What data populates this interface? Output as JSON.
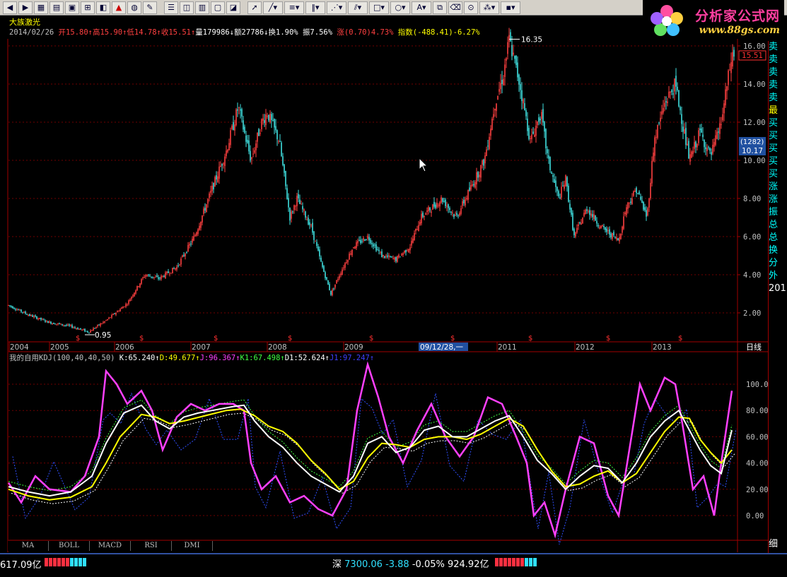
{
  "stock": {
    "name": "大族激光"
  },
  "quote": [
    {
      "text": "2014/02/26 ",
      "color": "#c0c0c0"
    },
    {
      "text": "开15.80",
      "color": "#ff4040"
    },
    {
      "text": "↑",
      "color": "#ff4040"
    },
    {
      "text": "高15.90",
      "color": "#ff4040"
    },
    {
      "text": "↑",
      "color": "#ff4040"
    },
    {
      "text": "低14.78",
      "color": "#ff4040"
    },
    {
      "text": "↑",
      "color": "#ff4040"
    },
    {
      "text": "收15.51",
      "color": "#ff4040"
    },
    {
      "text": "↑",
      "color": "#ff4040"
    },
    {
      "text": "量179986",
      "color": "#ffffff"
    },
    {
      "text": "↓",
      "color": "#ffffff"
    },
    {
      "text": "额27786",
      "color": "#ffffff"
    },
    {
      "text": "↓",
      "color": "#ffffff"
    },
    {
      "text": "换1.90% ",
      "color": "#ffffff"
    },
    {
      "text": "振7.56% ",
      "color": "#ffffff"
    },
    {
      "text": "涨",
      "color": "#ff4040"
    },
    {
      "text": "(0.70)",
      "color": "#ff4040"
    },
    {
      "text": "4.73% ",
      "color": "#ff4040"
    },
    {
      "text": "指数",
      "color": "#ffff00"
    },
    {
      "text": "(-488.41)",
      "color": "#ffff00"
    },
    {
      "text": "-6.27%",
      "color": "#ffff00"
    }
  ],
  "price_axis": {
    "labels": [
      "16.00",
      "14.00",
      "12.00",
      "10.00",
      "8.00",
      "6.00",
      "4.00",
      "2.00"
    ],
    "current_price": "15.51",
    "cursor_count": "(1282)",
    "cursor_price": "10.17"
  },
  "annotations": {
    "high": "16.35",
    "low": "0.95"
  },
  "time_axis": {
    "labels": [
      "2004",
      "2005",
      "2006",
      "2007",
      "2008",
      "2009",
      "2011",
      "2012",
      "2013"
    ],
    "cursor_date": "09/12/28,一",
    "period": "日线"
  },
  "kdj": {
    "header": [
      {
        "text": "我的自用KDJ(100,40,40,50) ",
        "color": "#c0c0c0"
      },
      {
        "text": "K:65.240",
        "color": "#ffffff"
      },
      {
        "text": "↑",
        "color": "#ffffff"
      },
      {
        "text": "D:49.677",
        "color": "#ffff00"
      },
      {
        "text": "↑",
        "color": "#ffff00"
      },
      {
        "text": "J:96.367",
        "color": "#ff40ff"
      },
      {
        "text": "↑",
        "color": "#ff40ff"
      },
      {
        "text": "K1:67.498",
        "color": "#40ff40"
      },
      {
        "text": "↑",
        "color": "#40ff40"
      },
      {
        "text": "D1:52.624",
        "color": "#ffffff"
      },
      {
        "text": "↑",
        "color": "#ffffff"
      },
      {
        "text": "J1:97.247",
        "color": "#4040ff"
      },
      {
        "text": "↑",
        "color": "#4040ff"
      }
    ],
    "axis": [
      "100.00",
      "80.00",
      "60.00",
      "40.00",
      "20.00",
      "0.00"
    ]
  },
  "right_panel": [
    {
      "text": "卖",
      "color": "#00ffff"
    },
    {
      "text": "卖",
      "color": "#00ffff"
    },
    {
      "text": "卖",
      "color": "#00ffff"
    },
    {
      "text": "卖",
      "color": "#00ffff"
    },
    {
      "text": "卖",
      "color": "#00ffff"
    },
    {
      "text": "最",
      "color": "#ffff00"
    },
    {
      "text": "买",
      "color": "#00ffff"
    },
    {
      "text": "买",
      "color": "#00ffff"
    },
    {
      "text": "买",
      "color": "#00ffff"
    },
    {
      "text": "买",
      "color": "#00ffff"
    },
    {
      "text": "买",
      "color": "#00ffff"
    },
    {
      "text": "涨",
      "color": "#00ffff"
    },
    {
      "text": "涨",
      "color": "#00ffff"
    },
    {
      "text": "振",
      "color": "#00ffff"
    },
    {
      "text": "总",
      "color": "#00ffff"
    },
    {
      "text": "总",
      "color": "#00ffff"
    },
    {
      "text": "换",
      "color": "#00ffff"
    },
    {
      "text": "分",
      "color": "#00ffff"
    },
    {
      "text": "外",
      "color": "#00ffff"
    },
    {
      "text": "201",
      "color": "#ffffff"
    }
  ],
  "right_panel_bottom": "细",
  "indicator_tabs": [
    "MA",
    "BOLL",
    "MACD",
    "RSI",
    "DMI"
  ],
  "status": {
    "left_amount": "617.09亿",
    "index_name": "深",
    "index_value": "7300.06",
    "index_change": "-3.88",
    "index_pct": "-0.05%",
    "index_amount": "924.92亿"
  },
  "logo": {
    "brand": "分析家公式网",
    "url": "www.88gs.com"
  },
  "colors": {
    "up": "#ff4040",
    "down": "#40e0e0",
    "grid": "#a00000",
    "k": "#ffffff",
    "d": "#ffff00",
    "j": "#ff40ff"
  },
  "toolbar_icons": [
    "back-icon",
    "forward-icon",
    "grid-icon",
    "book-icon",
    "tile-icon",
    "layout-icon",
    "image-icon",
    "alarm-icon",
    "info-icon",
    "draw-icon",
    "table-icon",
    "split-icon",
    "cal-icon",
    "window-icon",
    "chart-icon",
    "pointer-icon",
    "line-icon",
    "text-list-icon",
    "bars-icon",
    "fan-icon",
    "channel-icon",
    "rect-icon",
    "circle-icon",
    "text-icon",
    "copy-icon",
    "eraser-icon",
    "lock-icon",
    "palette-icon",
    "save-icon"
  ]
}
